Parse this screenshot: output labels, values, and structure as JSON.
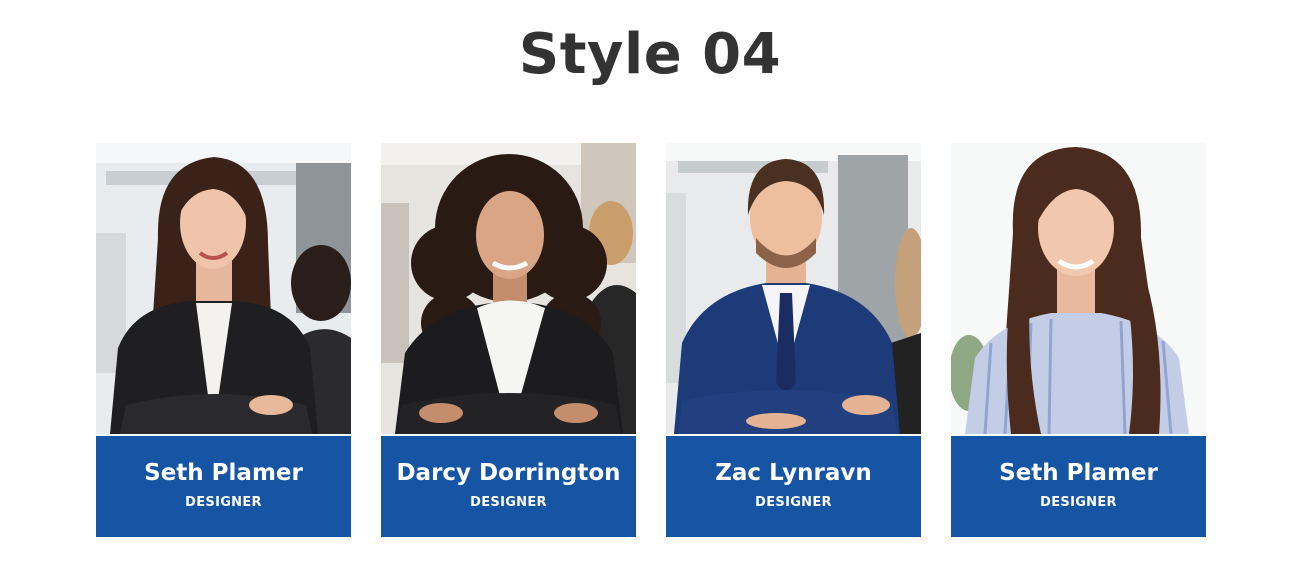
{
  "section": {
    "title": "Style 04"
  },
  "team": [
    {
      "name": "Seth Plamer",
      "role": "DESIGNER",
      "photo": "woman-dark-hair-black-blazer"
    },
    {
      "name": "Darcy Dorrington",
      "role": "DESIGNER",
      "photo": "woman-curly-hair-black-blazer"
    },
    {
      "name": "Zac Lynravn",
      "role": "DESIGNER",
      "photo": "man-navy-suit-tie"
    },
    {
      "name": "Seth Plamer",
      "role": "DESIGNER",
      "photo": "woman-long-hair-striped-shirt"
    }
  ],
  "colors": {
    "caption_bg": "#1555a4",
    "title_text": "#333333",
    "caption_text": "#ffffff"
  }
}
